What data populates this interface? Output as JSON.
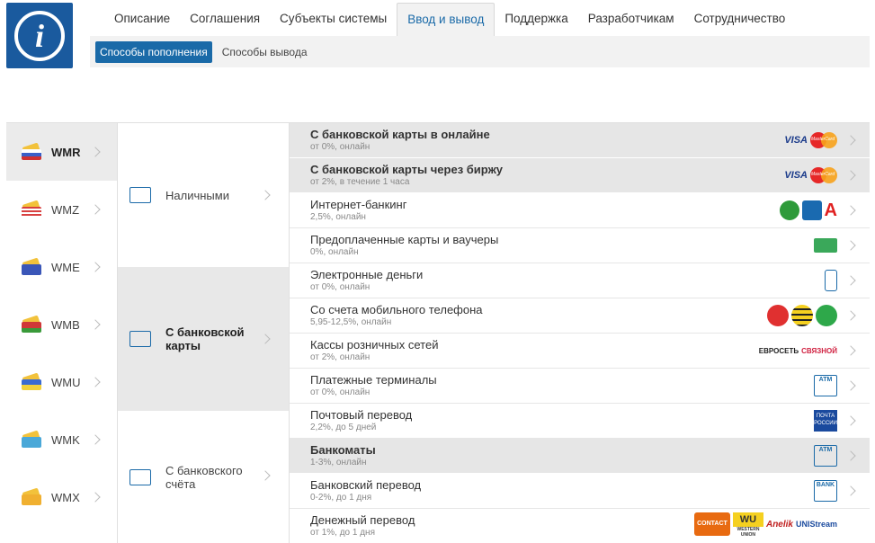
{
  "logo": {
    "glyph": "i"
  },
  "topnav": [
    "Описание",
    "Соглашения",
    "Субъекты системы",
    "Ввод и вывод",
    "Поддержка",
    "Разработчикам",
    "Сотрудничество"
  ],
  "subnav": [
    "Способы пополнения",
    "Способы вывода"
  ],
  "currencies": [
    "WMR",
    "WMZ",
    "WME",
    "WMB",
    "WMU",
    "WMK",
    "WMX"
  ],
  "methods": [
    "Наличными",
    "С банковской карты",
    "С банковского счёта"
  ],
  "rows": [
    {
      "title": "С банковской карты в онлайне",
      "sub": "от 0%, онлайн"
    },
    {
      "title": "С банковской карты через биржу",
      "sub": "от 2%, в течение 1 часа"
    },
    {
      "title": "Интернет-банкинг",
      "sub": "2,5%, онлайн"
    },
    {
      "title": "Предоплаченные карты и ваучеры",
      "sub": "0%, онлайн"
    },
    {
      "title": "Электронные деньги",
      "sub": "от 0%, онлайн"
    },
    {
      "title": "Со счета мобильного телефона",
      "sub": "5,95-12,5%, онлайн"
    },
    {
      "title": "Кассы розничных сетей",
      "sub": "от 2%, онлайн"
    },
    {
      "title": "Платежные терминалы",
      "sub": "от 0%, онлайн"
    },
    {
      "title": "Почтовый перевод",
      "sub": "2,2%, до 5 дней"
    },
    {
      "title": "Банкоматы",
      "sub": "1-3%, онлайн"
    },
    {
      "title": "Банковский перевод",
      "sub": "0-2%, до 1 дня"
    },
    {
      "title": "Денежный перевод",
      "sub": "от 1%, до 1 дня"
    }
  ],
  "logo_text": {
    "visa": "VISA",
    "mastercard": "MasterCard",
    "ab": "А",
    "evroset": "ЕВРОСЕТЬ",
    "svyaznoy": "СВЯЗНОЙ",
    "atm": "ATM",
    "pochta": "ПОЧТА РОССИИ",
    "bank": "BANK",
    "contact": "CONTACT",
    "wu": "WU",
    "wu_sub": "WESTERN UNION",
    "anelik": "Anelik",
    "unistream": "UNIStream"
  },
  "colors": {
    "accent": "#1a6aa8",
    "highlight": "#e6e6e6"
  }
}
